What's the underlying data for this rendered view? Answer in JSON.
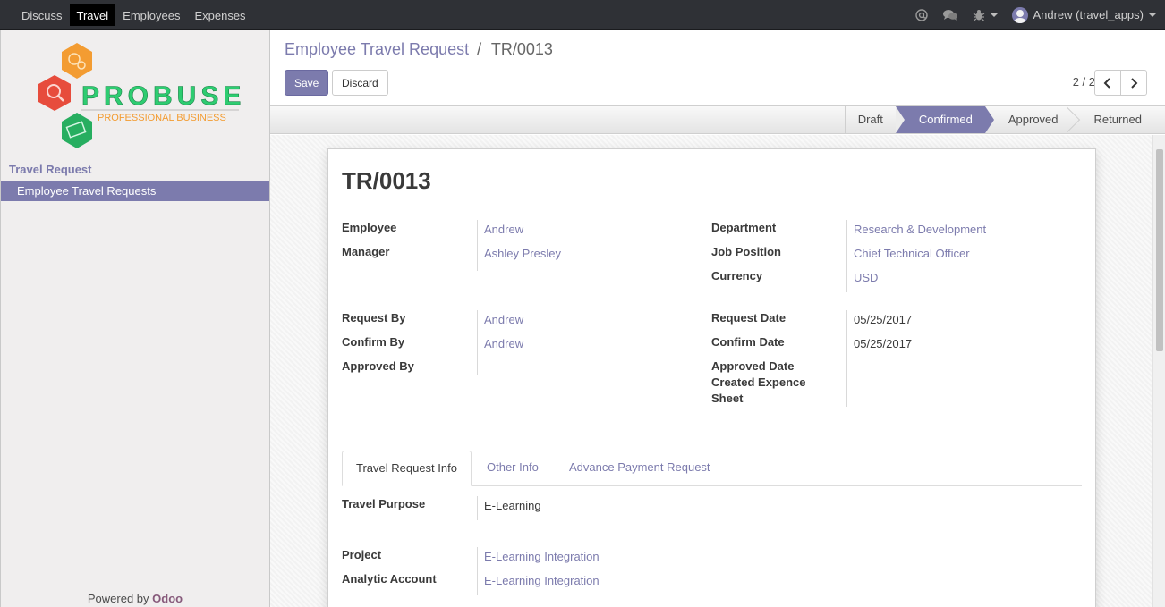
{
  "topbar": {
    "menu": [
      "Discuss",
      "Travel",
      "Employees",
      "Expenses"
    ],
    "active_index": 1,
    "user": "Andrew (travel_apps)",
    "icons": [
      "at-icon",
      "chat-icon",
      "bug-icon"
    ]
  },
  "sidebar": {
    "logo": {
      "brand": "PROBUSE",
      "tagline": "PROFESSIONAL BUSINESS"
    },
    "section": "Travel Request",
    "items": [
      {
        "label": "Employee Travel Requests",
        "active": true
      }
    ],
    "powered_prefix": "Powered by",
    "powered_brand": "Odoo"
  },
  "control": {
    "breadcrumb_parent": "Employee Travel Request",
    "breadcrumb_separator": "/",
    "breadcrumb_current": "TR/0013",
    "save_label": "Save",
    "discard_label": "Discard",
    "pager": "2 / 2"
  },
  "statusbar": {
    "stages": [
      "Draft",
      "Confirmed",
      "Approved",
      "Returned"
    ],
    "current": "Confirmed"
  },
  "form": {
    "title": "TR/0013",
    "left1": [
      {
        "label": "Employee",
        "value": "Andrew"
      },
      {
        "label": "Manager",
        "value": "Ashley Presley"
      }
    ],
    "right1": [
      {
        "label": "Department",
        "value": "Research & Development"
      },
      {
        "label": "Job Position",
        "value": "Chief Technical Officer"
      },
      {
        "label": "Currency",
        "value": "USD"
      }
    ],
    "left2": [
      {
        "label": "Request By",
        "value": "Andrew"
      },
      {
        "label": "Confirm By",
        "value": "Andrew"
      },
      {
        "label": "Approved By",
        "value": ""
      }
    ],
    "right2": [
      {
        "label": "Request Date",
        "value": "05/25/2017"
      },
      {
        "label": "Confirm Date",
        "value": "05/25/2017"
      },
      {
        "label": "Approved Date",
        "value": ""
      },
      {
        "label": "Created Expence Sheet",
        "value": ""
      }
    ],
    "tabs": [
      "Travel Request Info",
      "Other Info",
      "Advance Payment Request"
    ],
    "active_tab": 0,
    "tab_content": [
      {
        "label": "Travel Purpose",
        "value": "E-Learning"
      },
      {
        "label": "Project",
        "value": "E-Learning Integration"
      },
      {
        "label": "Analytic Account",
        "value": "E-Learning Integration"
      }
    ]
  },
  "colors": {
    "accent": "#7c7bad",
    "topbar": "#2f3136",
    "odoo": "#875a7b"
  }
}
